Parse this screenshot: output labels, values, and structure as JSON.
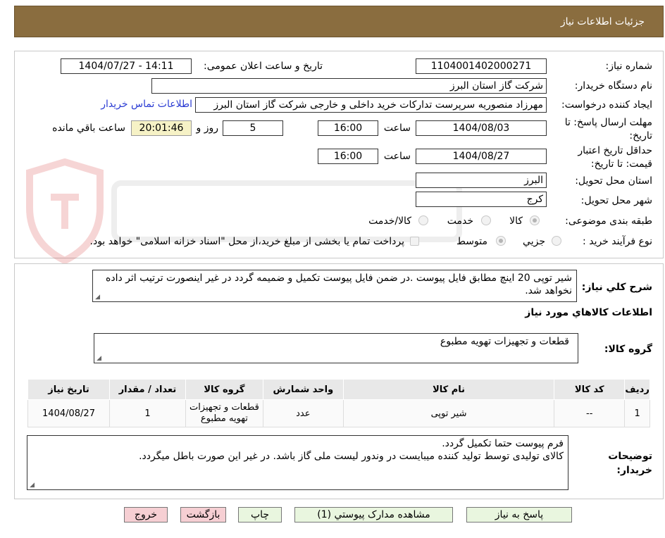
{
  "header": {
    "title": "جزئیات اطلاعات نیاز"
  },
  "form": {
    "need_number_label": "شماره نیاز:",
    "need_number": "1104001402000271",
    "announce_label": "تاریخ و ساعت اعلان عمومی:",
    "announce_value": "1404/07/27 - 14:11",
    "buyer_org_label": "نام دستگاه خریدار:",
    "buyer_org": "شرکت گاز استان البرز",
    "requester_label": "ایجاد کننده درخواست:",
    "requester": "مهرزاد منصوریه سرپرست تدارکات خرید داخلی و خارجی شرکت گاز استان البرز",
    "contact_link": "اطلاعات تماس خریدار",
    "deadline_label_1": "مهلت ارسال پاسخ: تا",
    "deadline_label_2": "تاریخ:",
    "deadline_date": "1404/08/03",
    "time_label": "ساعت",
    "deadline_time": "16:00",
    "days_value": "5",
    "days_label": "روز و",
    "remaining_time": "20:01:46",
    "remaining_label": "ساعت باقي مانده",
    "validity_label_1": "حداقل تاریخ اعتبار",
    "validity_label_2": "قیمت: تا تاریخ:",
    "validity_date": "1404/08/27",
    "validity_time": "16:00",
    "province_label": "استان محل تحویل:",
    "province": "البرز",
    "city_label": "شهر محل تحویل:",
    "city": "کرج",
    "category_label": "طبقه بندی موضوعی:",
    "category_options": [
      "کالا",
      "خدمت",
      "کالا/خدمت"
    ],
    "process_label": "نوع فرآیند خرید :",
    "process_options": [
      "جزیي",
      "متوسط"
    ],
    "payment_note": "پرداخت تمام یا بخشی از مبلغ خرید،از محل \"اسناد خزانه اسلامی\" خواهد بود."
  },
  "summary": {
    "label": "شرح کلي نياز:",
    "text": "شیر توپی 20 اینچ مطابق فایل پیوست .در ضمن فایل پیوست تکمیل و ضمیمه گردد در غیر اینصورت ترتیب اثر داده نخواهد شد.",
    "items_heading": "اطلاعات کالاهاي مورد نياز",
    "group_label": "گروه کالا:",
    "group_value": "قطعات و تجهیزات تهویه مطبوع"
  },
  "table": {
    "headers": [
      "ردیف",
      "کد کالا",
      "نام کالا",
      "واحد شمارش",
      "گروه کالا",
      "تعداد / مقدار",
      "تاریخ نیاز"
    ],
    "rows": [
      [
        "1",
        "--",
        "شیر توپی",
        "عدد",
        "قطعات و تجهیزات تهویه مطبوع",
        "1",
        "1404/08/27"
      ]
    ]
  },
  "buyer_notes": {
    "label_1": "توضیحات",
    "label_2": "خریدار:",
    "line1": "فرم پیوست حتما تکمیل گردد.",
    "line2": "کالای تولیدی توسط تولید کننده میبایست در وندور لیست ملی گاز باشد. در غیر این صورت باطل میگردد."
  },
  "buttons": {
    "reply": "پاسخ به نیاز",
    "attachments": "مشاهده مدارک پیوستي (1)",
    "print": "چاپ",
    "back": "بازگشت",
    "exit": "خروج"
  },
  "colors": {
    "header_bg": "#8a6d3f",
    "link": "#2a3bd3",
    "button_green": "#e9f6df",
    "button_pink": "#f6cfd3",
    "highlight_yellow": "#f6f2c6"
  }
}
